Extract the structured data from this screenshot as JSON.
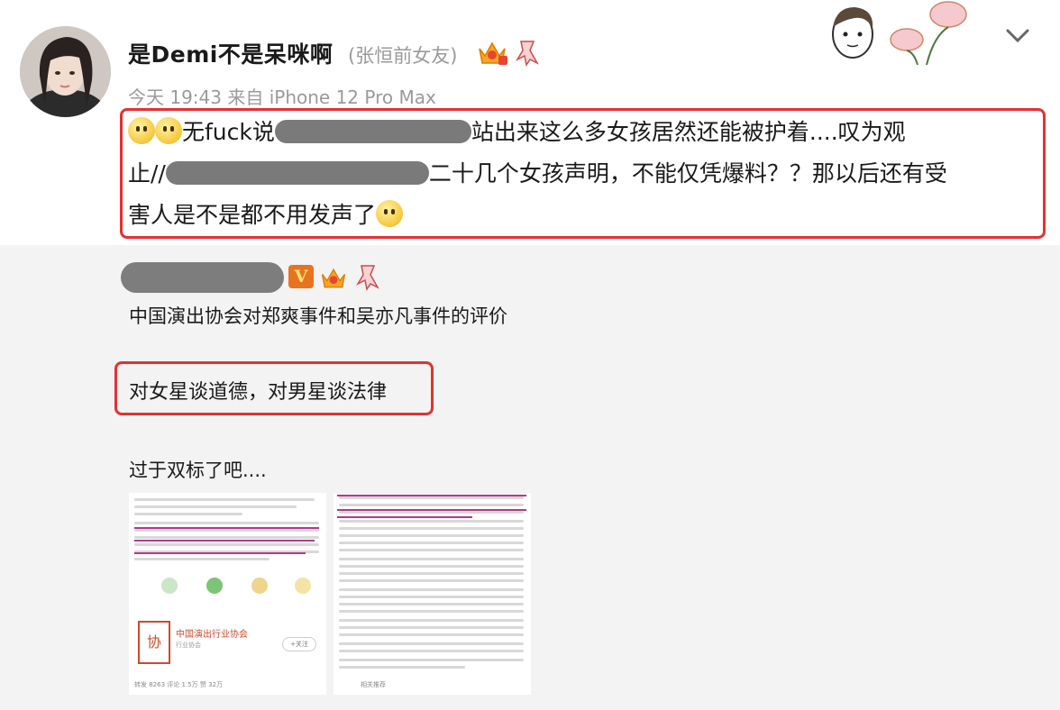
{
  "post": {
    "username": "是Demi不是呆咪啊",
    "remark": "(张恒前女友)",
    "time": "今天 19:43 来自 iPhone 12 Pro Max",
    "text_line1_prefix": "无fuck说",
    "text_line1_suffix": "站出来这么多女孩居然还能被护着....叹为观",
    "text_line2_prefix": "止//",
    "text_line2_suffix": "二十几个女孩声明，不能仅凭爆料？？那以后还有受",
    "text_line3": "害人是不是都不用发声了",
    "emojis": [
      "smile-emoji",
      "smile-emoji",
      "confused-emoji"
    ]
  },
  "repost": {
    "verified_badge": "V",
    "line1": "中国演出协会对郑爽事件和吴亦凡事件的评价",
    "highlight": "对女星谈道德，对男星谈法律",
    "line3": "过于双标了吧....",
    "thumb1": {
      "org_title": "中国演出行业协会",
      "org_sub": "行业协会",
      "seal_char": "协",
      "follow": "+关注",
      "footer": "转发 8263  评论 1.5万  赞 32万"
    },
    "thumb2": {
      "footer": "相关推荐"
    }
  },
  "colors": {
    "highlight_border": "#e2322f",
    "meta_gray": "#9a9a9a",
    "repost_bg": "#f3f3f3",
    "vip_orange": "#e8731f"
  },
  "icons": [
    "crown-icon",
    "ribbon-icon",
    "chevron-down-icon",
    "verified-v-icon",
    "avatar",
    "sticker-doodle"
  ]
}
